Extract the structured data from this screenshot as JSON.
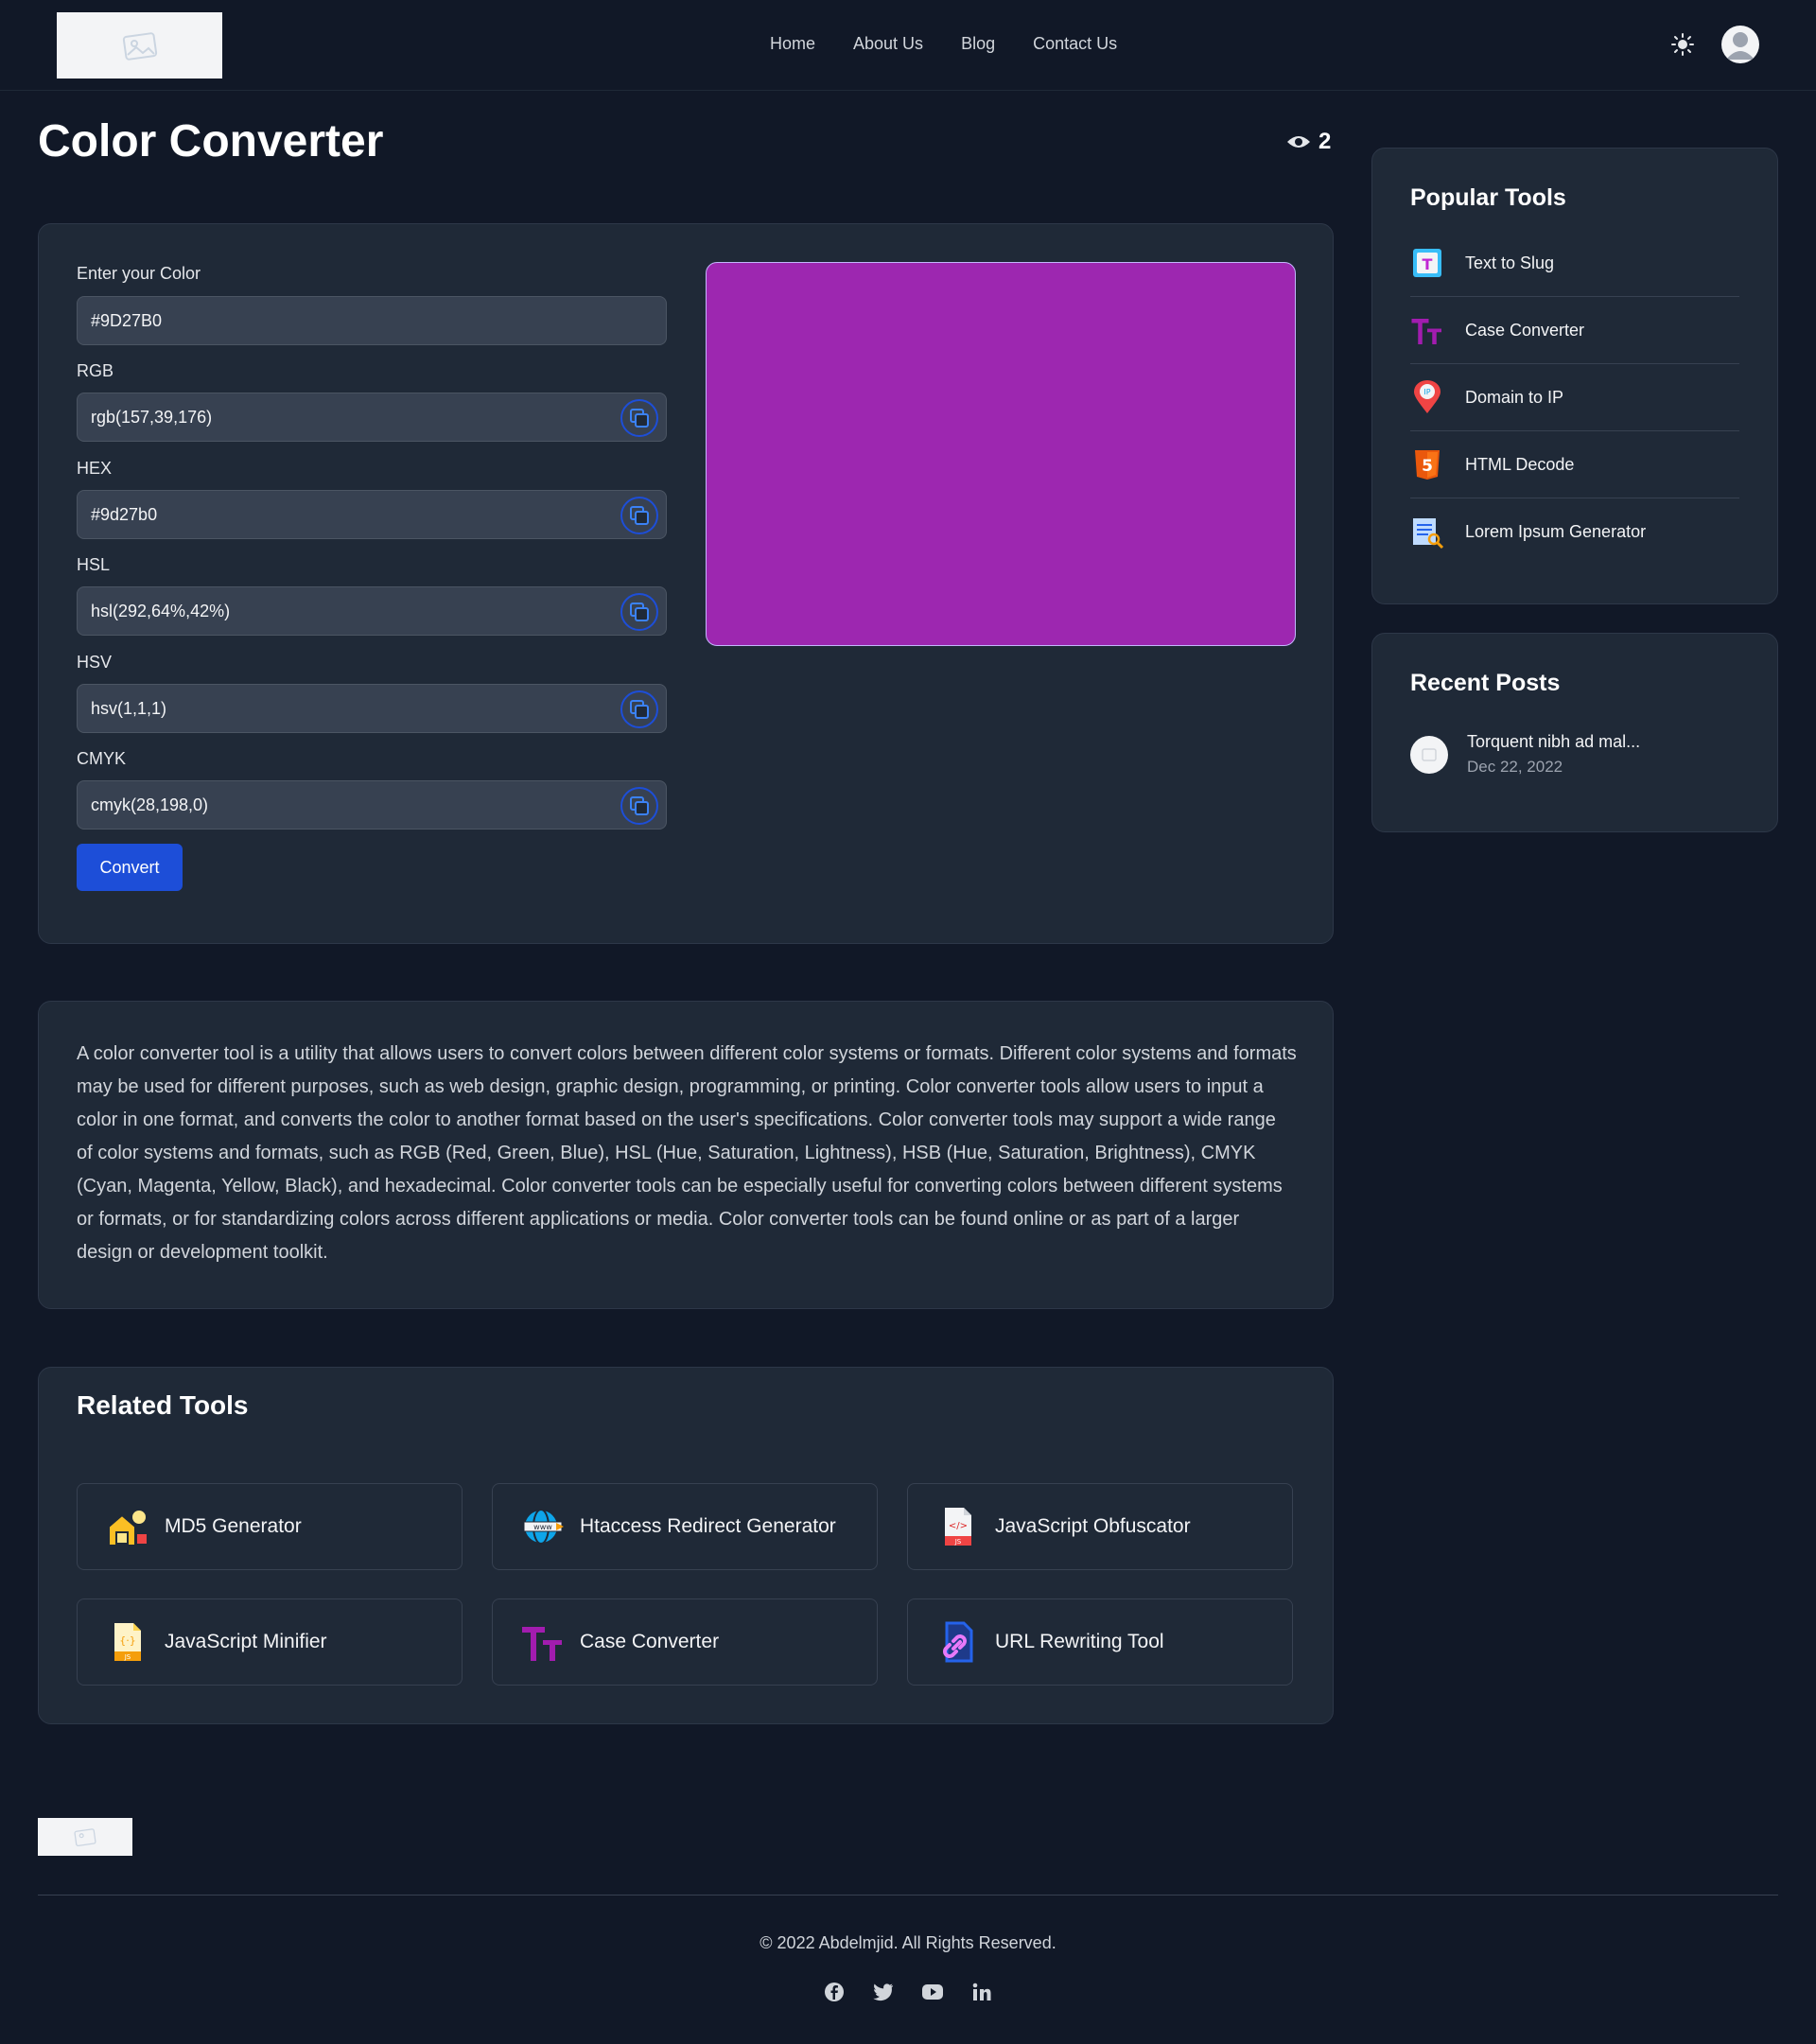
{
  "header": {
    "nav": [
      "Home",
      "About Us",
      "Blog",
      "Contact Us"
    ]
  },
  "page": {
    "title": "Color Converter",
    "views": "2"
  },
  "converter": {
    "input_label": "Enter your Color",
    "input_value": "#9D27B0",
    "fields": [
      {
        "label": "RGB",
        "value": "rgb(157,39,176)"
      },
      {
        "label": "HEX",
        "value": "#9d27b0"
      },
      {
        "label": "HSL",
        "value": "hsl(292,64%,42%)"
      },
      {
        "label": "HSV",
        "value": "hsv(1,1,1)"
      },
      {
        "label": "CMYK",
        "value": "cmyk(28,198,0)"
      }
    ],
    "convert_label": "Convert",
    "preview_color": "#9d27b0"
  },
  "description": "A color converter tool is a utility that allows users to convert colors between different color systems or formats. Different color systems and formats may be used for different purposes, such as web design, graphic design, programming, or printing. Color converter tools allow users to input a color in one format, and converts the color to another format based on the user's specifications. Color converter tools may support a wide range of color systems and formats, such as RGB (Red, Green, Blue), HSL (Hue, Saturation, Lightness), HSB (Hue, Saturation, Brightness), CMYK (Cyan, Magenta, Yellow, Black), and hexadecimal. Color converter tools can be especially useful for converting colors between different systems or formats, or for standardizing colors across different applications or media. Color converter tools can be found online or as part of a larger design or development toolkit.",
  "related": {
    "title": "Related Tools",
    "tools": [
      {
        "label": "MD5 Generator",
        "icon": "md5-icon"
      },
      {
        "label": "Htaccess Redirect Generator",
        "icon": "www-globe-icon"
      },
      {
        "label": "JavaScript Obfuscator",
        "icon": "js-file-icon"
      },
      {
        "label": "JavaScript Minifier",
        "icon": "js-minifier-icon"
      },
      {
        "label": "Case Converter",
        "icon": "case-tt-icon"
      },
      {
        "label": "URL Rewriting Tool",
        "icon": "link-icon"
      }
    ]
  },
  "sidebar": {
    "popular_title": "Popular Tools",
    "popular": [
      {
        "label": "Text to Slug",
        "icon": "text-t-icon"
      },
      {
        "label": "Case Converter",
        "icon": "case-tt-icon"
      },
      {
        "label": "Domain to IP",
        "icon": "ip-pin-icon"
      },
      {
        "label": "HTML Decode",
        "icon": "html5-icon"
      },
      {
        "label": "Lorem Ipsum Generator",
        "icon": "document-search-icon"
      }
    ],
    "recent_title": "Recent Posts",
    "recent": [
      {
        "title": "Torquent nibh ad mal...",
        "date": "Dec 22, 2022"
      }
    ]
  },
  "footer": {
    "copyright": "© 2022 Abdelmjid. All Rights Reserved."
  },
  "colors": {
    "background": "#111827",
    "card": "#1f2937",
    "accent": "#1d4ed8"
  }
}
